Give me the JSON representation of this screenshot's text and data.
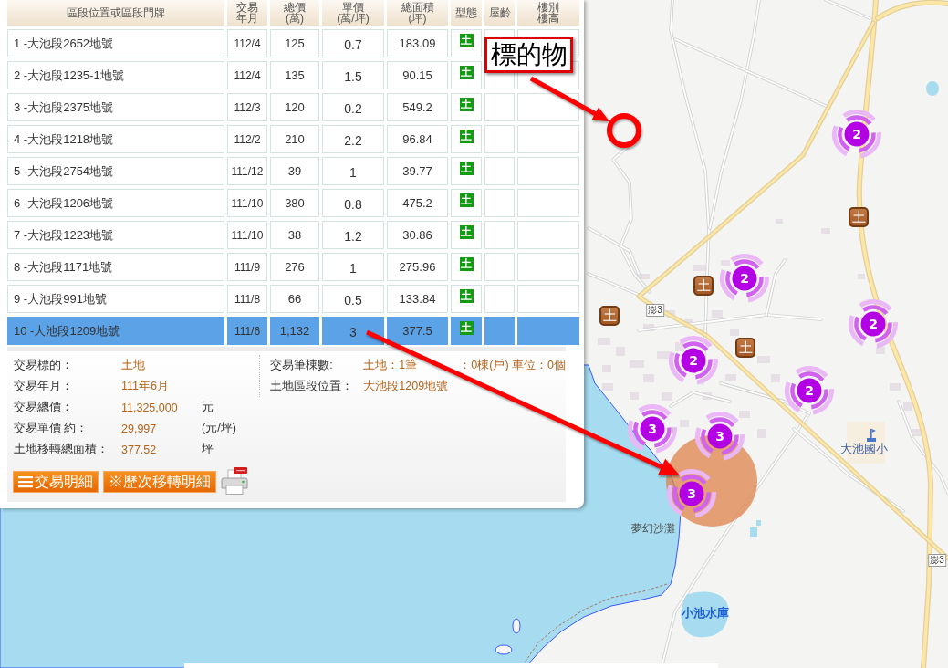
{
  "table": {
    "columns": [
      [
        "區段位置或區段門牌"
      ],
      [
        "交易",
        "年月"
      ],
      [
        "總價",
        "(萬)"
      ],
      [
        "單價",
        "(萬/坪)"
      ],
      [
        "總面積",
        "(坪)"
      ],
      [
        "型態"
      ],
      [
        "屋齡"
      ],
      [
        "樓別",
        "樓高"
      ]
    ],
    "rows": [
      {
        "location": "1 -大池段2652地號",
        "month": "112/4",
        "total_price": "125",
        "unit_price": "0.7",
        "area": "183.09",
        "type": "土",
        "selected": false
      },
      {
        "location": "2 -大池段1235-1地號",
        "month": "112/4",
        "total_price": "135",
        "unit_price": "1.5",
        "area": "90.15",
        "type": "土",
        "selected": false
      },
      {
        "location": "3 -大池段2375地號",
        "month": "112/3",
        "total_price": "120",
        "unit_price": "0.2",
        "area": "549.2",
        "type": "土",
        "selected": false
      },
      {
        "location": "4 -大池段1218地號",
        "month": "112/2",
        "total_price": "210",
        "unit_price": "2.2",
        "area": "96.84",
        "type": "土",
        "selected": false
      },
      {
        "location": "5 -大池段2754地號",
        "month": "111/12",
        "total_price": "39",
        "unit_price": "1",
        "area": "39.77",
        "type": "土",
        "selected": false
      },
      {
        "location": "6 -大池段1206地號",
        "month": "111/10",
        "total_price": "380",
        "unit_price": "0.8",
        "area": "475.2",
        "type": "土",
        "selected": false
      },
      {
        "location": "7 -大池段1223地號",
        "month": "111/10",
        "total_price": "38",
        "unit_price": "1.2",
        "area": "30.86",
        "type": "土",
        "selected": false
      },
      {
        "location": "8 -大池段1171地號",
        "month": "111/9",
        "total_price": "276",
        "unit_price": "1",
        "area": "275.96",
        "type": "土",
        "selected": false
      },
      {
        "location": "9 -大池段991地號",
        "month": "111/8",
        "total_price": "66",
        "unit_price": "0.5",
        "area": "133.84",
        "type": "土",
        "selected": false
      },
      {
        "location": "10 -大池段1209地號",
        "month": "111/6",
        "total_price": "1,132",
        "unit_price": "3",
        "area": "377.5",
        "type": "土",
        "selected": true
      }
    ]
  },
  "details": {
    "left": [
      {
        "label": "交易標的：",
        "value": "土地"
      },
      {
        "label": "交易年月：",
        "value": "111年6月"
      },
      {
        "label": "交易總價：",
        "value": "11,325,000",
        "unit": "元"
      },
      {
        "label": "交易單價 約：",
        "value": "29,997",
        "unit": "(元/坪)"
      },
      {
        "label": "土地移轉總面積：",
        "value": "377.52",
        "unit": "坪"
      }
    ],
    "right": [
      {
        "label": "交易筆棟數:",
        "values": [
          "土地：1筆",
          "：0棟(戶) 車位：0個"
        ]
      },
      {
        "label": "土地區段位置：",
        "values": [
          "大池段1209地號"
        ]
      }
    ]
  },
  "buttons": [
    {
      "label": "交易明細",
      "kind": "list"
    },
    {
      "label": "※歷次移轉明細",
      "kind": "plain"
    }
  ],
  "callout": {
    "label": "標的物"
  },
  "map": {
    "clusters": [
      "2",
      "2",
      "2",
      "2",
      "2",
      "3",
      "3",
      "3"
    ],
    "land_markers": [
      "土",
      "土",
      "土",
      "土"
    ],
    "road_shields": [
      "澎3",
      "澎3"
    ],
    "places": [
      {
        "name": "大池國小",
        "kind": "school"
      },
      {
        "name": "夢幻沙灘",
        "kind": "beach"
      },
      {
        "name": "小池水庫",
        "kind": "reservoir"
      }
    ]
  }
}
